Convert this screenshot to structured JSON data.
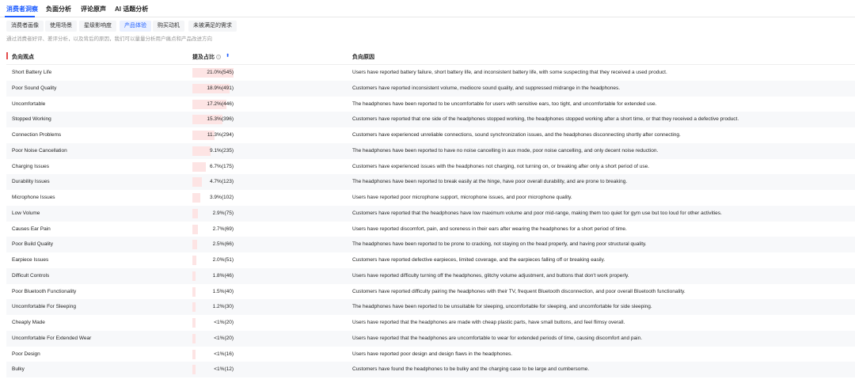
{
  "top_tabs": [
    {
      "label": "消费者洞察",
      "active": true
    },
    {
      "label": "负面分析",
      "active": false
    },
    {
      "label": "评论原声",
      "active": false
    },
    {
      "label": "AI 话题分析",
      "active": false
    }
  ],
  "sub_tabs": [
    {
      "label": "消费者画像",
      "active": false
    },
    {
      "label": "使用场景",
      "active": false
    },
    {
      "label": "星级影响度",
      "active": false
    },
    {
      "label": "产品体验",
      "active": true
    },
    {
      "label": "购买动机",
      "active": false
    },
    {
      "label": "未被满足的需求",
      "active": false
    }
  ],
  "description": "通过消费者好评、差评分析，以及背后的原因，我们可以量量分析用户痛点和产品改进方向",
  "table": {
    "headers": {
      "viewpoint": "负向观点",
      "ratio": "提及占比",
      "reason": "负向原因"
    },
    "rows": [
      {
        "name": "Short Battery Life",
        "ratio": 0.21,
        "pct": "21.0%(545)",
        "reason": "Users have reported battery failure, short battery life, and inconsistent battery life, with some suspecting that they received a used product."
      },
      {
        "name": "Poor Sound Quality",
        "ratio": 0.189,
        "pct": "18.9%(491)",
        "reason": "Customers have reported inconsistent volume, mediocre sound quality, and suppressed midrange in the headphones."
      },
      {
        "name": "Uncomfortable",
        "ratio": 0.172,
        "pct": "17.2%(446)",
        "reason": "The headphones have been reported to be uncomfortable for users with sensitive ears, too tight, and uncomfortable for extended use."
      },
      {
        "name": "Stopped Working",
        "ratio": 0.153,
        "pct": "15.3%(396)",
        "reason": "Customers have reported that one side of the headphones stopped working, the headphones stopped working after a short time, or that they received a defective product."
      },
      {
        "name": "Connection Problems",
        "ratio": 0.113,
        "pct": "11.3%(294)",
        "reason": "Customers have experienced unreliable connections, sound synchronization issues, and the headphones disconnecting shortly after connecting."
      },
      {
        "name": "Poor Noise Cancellation",
        "ratio": 0.091,
        "pct": "9.1%(235)",
        "reason": "The headphones have been reported to have no noise cancelling in aux mode, poor noise cancelling, and only decent noise reduction."
      },
      {
        "name": "Charging Issues",
        "ratio": 0.067,
        "pct": "6.7%(175)",
        "reason": "Customers have experienced issues with the headphones not charging, not turning on, or breaking after only a short period of use."
      },
      {
        "name": "Durability Issues",
        "ratio": 0.047,
        "pct": "4.7%(123)",
        "reason": "The headphones have been reported to break easily at the hinge, have poor overall durability, and are prone to breaking."
      },
      {
        "name": "Microphone Issues",
        "ratio": 0.039,
        "pct": "3.9%(102)",
        "reason": "Users have reported poor microphone support, microphone issues, and poor microphone quality."
      },
      {
        "name": "Low Volume",
        "ratio": 0.029,
        "pct": "2.9%(75)",
        "reason": "Customers have reported that the headphones have low maximum volume and poor mid-range, making them too quiet for gym use but too loud for other activities."
      },
      {
        "name": "Causes Ear Pain",
        "ratio": 0.027,
        "pct": "2.7%(69)",
        "reason": "Users have reported discomfort, pain, and soreness in their ears after wearing the headphones for a short period of time."
      },
      {
        "name": "Poor Build Quality",
        "ratio": 0.025,
        "pct": "2.5%(66)",
        "reason": "The headphones have been reported to be prone to cracking, not staying on the head properly, and having poor structural quality."
      },
      {
        "name": "Earpiece Issues",
        "ratio": 0.02,
        "pct": "2.0%(51)",
        "reason": "Customers have reported defective earpieces, limited coverage, and the earpieces falling off or breaking easily."
      },
      {
        "name": "Difficult Controls",
        "ratio": 0.018,
        "pct": "1.8%(46)",
        "reason": "Users have reported difficulty turning off the headphones, glitchy volume adjustment, and buttons that don't work properly."
      },
      {
        "name": "Poor Bluetooth Functionality",
        "ratio": 0.015,
        "pct": "1.5%(40)",
        "reason": "Customers have reported difficulty pairing the headphones with their TV, frequent Bluetooth disconnection, and poor overall Bluetooth functionality."
      },
      {
        "name": "Uncomfortable For Sleeping",
        "ratio": 0.012,
        "pct": "1.2%(30)",
        "reason": "The headphones have been reported to be unsuitable for sleeping, uncomfortable for sleeping, and uncomfortable for side sleeping."
      },
      {
        "name": "Cheaply Made",
        "ratio": 0.008,
        "pct": "<1%(20)",
        "reason": "Users have reported that the headphones are made with cheap plastic parts, have small buttons, and feel flimsy overall."
      },
      {
        "name": "Uncomfortable For Extended Wear",
        "ratio": 0.008,
        "pct": "<1%(20)",
        "reason": "Users have reported that the headphones are uncomfortable to wear for extended periods of time, causing discomfort and pain."
      },
      {
        "name": "Poor Design",
        "ratio": 0.006,
        "pct": "<1%(16)",
        "reason": "Users have reported poor design and design flaws in the headphones."
      },
      {
        "name": "Bulky",
        "ratio": 0.005,
        "pct": "<1%(12)",
        "reason": "Customers have found the headphones to be bulky and the charging case to be large and cumbersome."
      }
    ]
  },
  "colors": {
    "accent": "#1f5eff",
    "bar": "#fde4e4",
    "marker": "#e34d4d"
  },
  "icons": {
    "info": "info-circle-icon",
    "sort": "sort-icon"
  }
}
